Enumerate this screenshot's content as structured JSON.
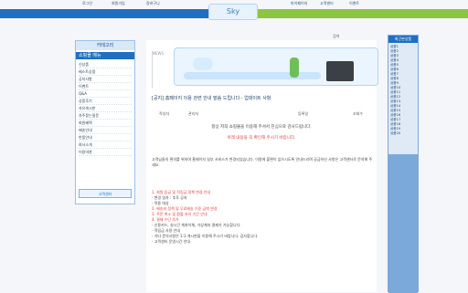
{
  "top": {
    "logo": "Sky",
    "left_links": [
      "로그인",
      "회원가입",
      "장바구니"
    ],
    "right_links": [
      "마이페이지",
      "고객센터",
      "이벤트"
    ]
  },
  "left": {
    "header": "카테고리",
    "title": "쇼핑몰 메뉴",
    "items": [
      "신상품",
      "베스트상품",
      "공지사항",
      "이벤트",
      "Q&A",
      "상품후기",
      "자유게시판",
      "자주묻는질문",
      "회원혜택",
      "배송안내",
      "반품안내",
      "회사소개",
      "이용약관"
    ],
    "banner": "고객센터"
  },
  "main": {
    "side_caption": "NEWS",
    "post_title": "[공지] 홈페이지 이용 관련 안내 말씀 드립니다 - 업데이트 사항",
    "post_meta": [
      "작성자",
      "관리자",
      "등록일",
      "조회수"
    ],
    "lead": "항상 저희 쇼핑몰을 이용해 주셔서 진심으로 감사드립니다.",
    "lead_red": "아래 내용을 꼭 확인해 주시기 바랍니다.",
    "paragraph": "고객님들의 편의를 위하여 홈페이지 일부 서비스가 변경되었습니다. 이용에 불편이 없으시도록 안내드리며 궁금하신 사항은 고객센터로 문의해 주세요.",
    "list": [
      {
        "text": "1. 회원 등급 및 적립금 정책 변경 안내",
        "red": true
      },
      {
        "text": "- 변경 일자 : 추후 공지",
        "red": false
      },
      {
        "text": "- 적용 대상",
        "red": false
      },
      {
        "text": "2. 배송비 정책 및 무료배송 기준 금액 변경",
        "red": true
      },
      {
        "text": "3. 주문 취소 및 환불 처리 기간 안내",
        "red": true
      },
      {
        "text": "4. 결제 수단 추가",
        "red": true
      },
      {
        "text": "- 신용카드, 실시간 계좌이체, 가상계좌 결제가 가능합니다.",
        "red": false
      },
      {
        "text": "- 적립금 사용 안내",
        "red": false
      },
      {
        "text": "- 기타 문의사항은 1:1 게시판을 이용해 주시기 바랍니다. 감사합니다.",
        "red": false
      },
      {
        "text": "- 고객센터 운영시간 안내",
        "red": false
      }
    ]
  },
  "search": "검색",
  "right": {
    "header": "최근본상품",
    "items": [
      "상품1",
      "상품2",
      "상품3",
      "상품4",
      "상품5",
      "상품6",
      "상품7",
      "상품8",
      "상품9",
      "상품10",
      "상품11",
      "상품12",
      "상품13",
      "상품14",
      "상품15",
      "상품16",
      "상품17",
      "상품18",
      "상품19",
      "상품20"
    ]
  }
}
